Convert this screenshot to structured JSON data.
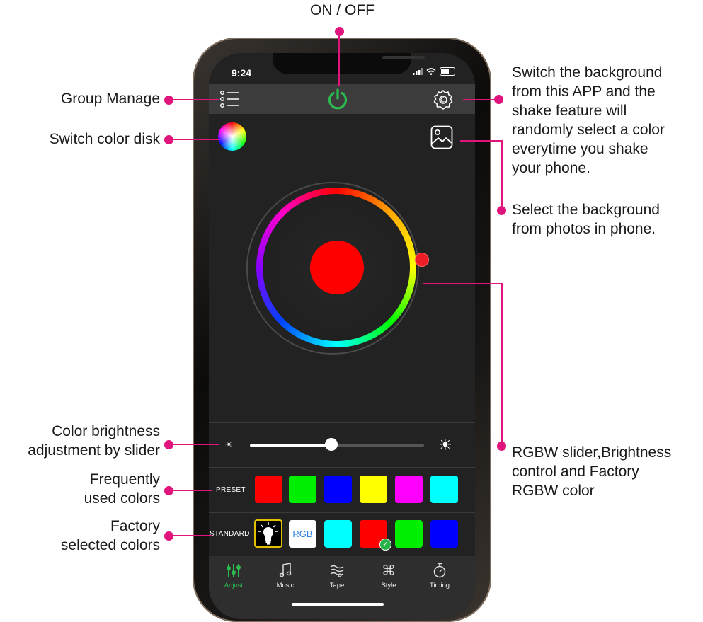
{
  "annotations": {
    "on_off": "ON / OFF",
    "group_manage": "Group Manage",
    "switch_color_disk": "Switch color disk",
    "switch_background": [
      "Switch the background",
      "from this APP and the",
      "shake feature will",
      "randomly select a color",
      "everytime you shake",
      "your phone."
    ],
    "select_background": [
      "Select the background",
      "from photos in phone."
    ],
    "brightness": [
      "Color brightness",
      "adjustment by slider"
    ],
    "frequent": [
      "Frequently",
      "used colors"
    ],
    "factory": [
      "Factory",
      "selected colors"
    ],
    "rgbw": [
      "RGBW slider,Brightness",
      "control and Factory",
      "RGBW color"
    ]
  },
  "status": {
    "time": "9:24"
  },
  "icons": {
    "menu": "list-menu-icon",
    "power": "power-icon",
    "settings": "gear-icon",
    "color_disk": "color-disk-icon",
    "photo": "photo-icon",
    "sun_small": "☀",
    "sun_large": "☀"
  },
  "colors": {
    "accent_green": "#2bbb4f",
    "annotation": "#e0147c",
    "selected": "#ff0000"
  },
  "slider": {
    "brightness_fraction": 0.46
  },
  "preset": {
    "label": "PRESET",
    "swatches": [
      "#ff0000",
      "#00ee00",
      "#0000ff",
      "#ffff00",
      "#ff00ff",
      "#00ffff"
    ]
  },
  "standard": {
    "label": "STANDARD",
    "rgb_label": "RGB",
    "swatches": [
      "#00ffff",
      "#ff0000",
      "#00ee00",
      "#0000ff"
    ]
  },
  "tabs": [
    {
      "label": "Adjust",
      "icon": "adjust-sliders-icon",
      "active": true
    },
    {
      "label": "Music",
      "icon": "music-note-icon",
      "active": false
    },
    {
      "label": "Tape",
      "icon": "tape-wave-icon",
      "active": false
    },
    {
      "label": "Style",
      "icon": "command-icon",
      "active": false
    },
    {
      "label": "Timing",
      "icon": "timer-icon",
      "active": false
    }
  ]
}
